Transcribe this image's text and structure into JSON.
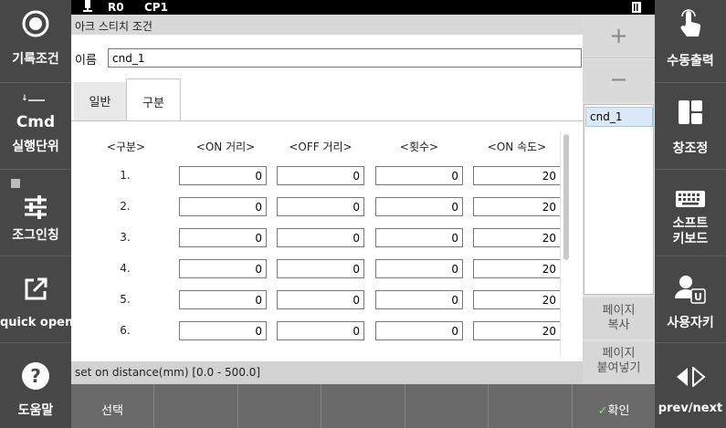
{
  "status_bar": {
    "robot": "R0",
    "program": "CP1"
  },
  "left_sidebar": [
    {
      "icon": "record-icon",
      "label": "기록조건"
    },
    {
      "icon": "cmd-icon",
      "top": "Cmd",
      "label": "실행단위"
    },
    {
      "icon": "sliders-icon",
      "label": "조그인칭"
    },
    {
      "icon": "external-link-icon",
      "label": "quick open"
    },
    {
      "icon": "help-icon",
      "label": "도움말"
    }
  ],
  "right_sidebar": [
    {
      "icon": "hand-pointer-icon",
      "label": "수동출력"
    },
    {
      "icon": "window-layout-icon",
      "label": "창조정"
    },
    {
      "icon": "keyboard-icon",
      "label": "소프트\n키보드"
    },
    {
      "icon": "user-icon",
      "label": "사용자키"
    },
    {
      "icon": "prev-next-icon",
      "label": "prev/next"
    }
  ],
  "panel": {
    "title": "아크 스티치 조건",
    "name_label": "이름",
    "name_value": "cnd_1",
    "tabs": [
      "일반",
      "구분"
    ],
    "active_tab": 1,
    "headers": [
      "<구분>",
      "<ON 거리>",
      "<OFF 거리>",
      "<횟수>",
      "<ON 속도>"
    ],
    "rows": [
      {
        "label": "1.",
        "on_dist": "0",
        "off_dist": "0",
        "count": "0",
        "on_speed": "20"
      },
      {
        "label": "2.",
        "on_dist": "0",
        "off_dist": "0",
        "count": "0",
        "on_speed": "20"
      },
      {
        "label": "3.",
        "on_dist": "0",
        "off_dist": "0",
        "count": "0",
        "on_speed": "20"
      },
      {
        "label": "4.",
        "on_dist": "0",
        "off_dist": "0",
        "count": "0",
        "on_speed": "20"
      },
      {
        "label": "5.",
        "on_dist": "0",
        "off_dist": "0",
        "count": "0",
        "on_speed": "20"
      },
      {
        "label": "6.",
        "on_dist": "0",
        "off_dist": "0",
        "count": "0",
        "on_speed": "20"
      }
    ],
    "status_text": "set on distance(mm) [0.0 - 500.0]"
  },
  "list_panel": {
    "add": "+",
    "remove": "−",
    "items": [
      "cnd_1"
    ],
    "page_copy": "페이지\n복사",
    "page_paste": "페이지\n붙여넣기"
  },
  "bottom_bar": {
    "select": "선택",
    "confirm": "확인"
  }
}
